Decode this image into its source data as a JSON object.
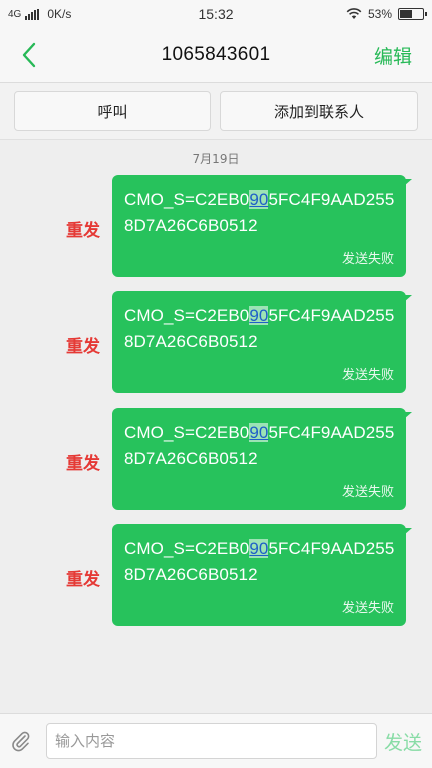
{
  "status_bar": {
    "network": "4G",
    "speed": "0K/s",
    "time": "15:32",
    "battery": "53%",
    "battery_level": 0.53
  },
  "header": {
    "title": "1065843601",
    "edit_label": "编辑",
    "back_icon": "chevron-left-icon",
    "accent_color": "#27b957"
  },
  "actions": {
    "call_label": "呼叫",
    "add_contact_label": "添加到联系人"
  },
  "conversation": {
    "date": "7月19日",
    "messages": [
      {
        "text_before": "CMO_S=C2EB0",
        "text_highlight": "90",
        "text_after": "5FC4F9AAD2558D7A26C6B0512",
        "status": "发送失败",
        "resend_label": "重发"
      },
      {
        "text_before": "CMO_S=C2EB0",
        "text_highlight": "90",
        "text_after": "5FC4F9AAD2558D7A26C6B0512",
        "status": "发送失败",
        "resend_label": "重发"
      },
      {
        "text_before": "CMO_S=C2EB0",
        "text_highlight": "90",
        "text_after": "5FC4F9AAD2558D7A26C6B0512",
        "status": "发送失败",
        "resend_label": "重发"
      },
      {
        "text_before": "CMO_S=C2EB0",
        "text_highlight": "90",
        "text_after": "5FC4F9AAD2558D7A26C6B0512",
        "status": "发送失败",
        "resend_label": "重发"
      }
    ],
    "bubble_color": "#27c25c",
    "resend_color": "#e53935"
  },
  "input_bar": {
    "placeholder": "输入内容",
    "send_label": "发送",
    "attach_icon": "paperclip-icon"
  }
}
